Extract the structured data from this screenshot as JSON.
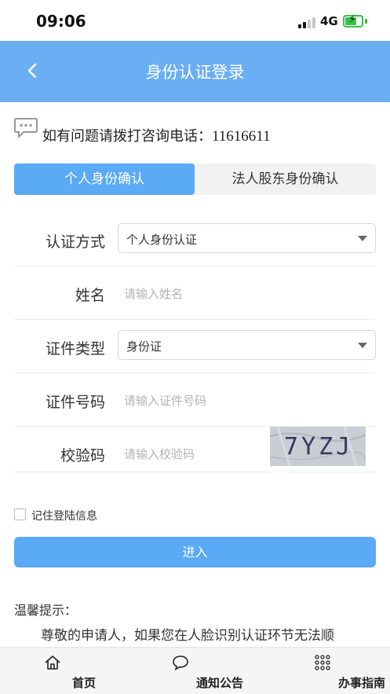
{
  "status_bar": {
    "time": "09:06",
    "network": "4G"
  },
  "nav": {
    "title": "身份认证登录"
  },
  "hotline": {
    "prefix": "如有问题请拨打咨询电话：",
    "phone": "11616611"
  },
  "tabs": [
    {
      "label": "个人身份确认",
      "active": true
    },
    {
      "label": "法人股东身份确认",
      "active": false
    }
  ],
  "form": {
    "auth_method": {
      "label": "认证方式",
      "value": "个人身份认证"
    },
    "name": {
      "label": "姓名",
      "placeholder": "请输入姓名"
    },
    "id_type": {
      "label": "证件类型",
      "value": "身份证"
    },
    "id_number": {
      "label": "证件号码",
      "placeholder": "请输入证件号码"
    },
    "captcha": {
      "label": "校验码",
      "placeholder": "请输入校验码",
      "image_text": "7YZJ"
    }
  },
  "remember": {
    "label": "记住登陆信息",
    "checked": false
  },
  "submit": {
    "label": "进入"
  },
  "tips": {
    "title": "温馨提示：",
    "body": "尊敬的申请人，如果您在人脸识别认证环节无法顺"
  },
  "bottom_tabs": [
    {
      "label": "首页",
      "icon": "home-icon"
    },
    {
      "label": "通知公告",
      "icon": "chat-bubble-icon"
    },
    {
      "label": "办事指南",
      "icon": "grid-icon"
    }
  ],
  "colors": {
    "accent": "#5aaaf5",
    "nav": "#6aaef3",
    "battery": "#35c24a"
  }
}
